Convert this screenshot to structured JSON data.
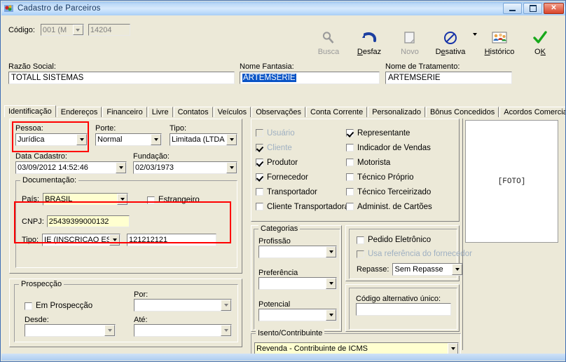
{
  "window": {
    "title": "Cadastro de Parceiros",
    "icon": "app-icon",
    "minimize_label": "Minimizar",
    "maximize_label": "Maximizar",
    "close_label": "Fechar"
  },
  "toolbar": {
    "codigo_label": "Código:",
    "codigo_combo_value": "001 (M",
    "codigo_number_value": "14204",
    "buttons": [
      {
        "label": "Busca",
        "underline": "B",
        "icon": "magnifier-icon",
        "disabled": true
      },
      {
        "label": "Desfaz",
        "underline": "D",
        "icon": "undo-arrow-icon",
        "disabled": false
      },
      {
        "label": "Novo",
        "underline": "N",
        "icon": "new-document-icon",
        "disabled": true
      },
      {
        "label": "Desativa",
        "underline": "e",
        "icon": "no-entry-icon",
        "disabled": false
      },
      {
        "label": "Histórico",
        "underline": "H",
        "icon": "people-icon",
        "disabled": false
      },
      {
        "label": "OK",
        "underline": "K",
        "icon": "green-check-icon",
        "disabled": false
      }
    ],
    "dropdown_caret": "chevron-down-icon"
  },
  "header_fields": {
    "razao_social": {
      "label": "Razão Social:",
      "value": "TOTALL SISTEMAS"
    },
    "nome_fantasia": {
      "label": "Nome Fantasia:",
      "value": "ARTEMSERIE",
      "selected": true
    },
    "nome_tratamento": {
      "label": "Nome de Tratamento:",
      "value": "ARTEMSERIE"
    }
  },
  "tabs": [
    {
      "label": "Identificação",
      "active": true
    },
    {
      "label": "Endereços",
      "active": false
    },
    {
      "label": "Financeiro",
      "active": false
    },
    {
      "label": "Livre",
      "active": false
    },
    {
      "label": "Contatos",
      "active": false
    },
    {
      "label": "Veículos",
      "active": false
    },
    {
      "label": "Observações",
      "active": false
    },
    {
      "label": "Conta Corrente",
      "active": false
    },
    {
      "label": "Personalizado",
      "active": false
    },
    {
      "label": "Bônus Concedidos",
      "active": false
    },
    {
      "label": "Acordos Comerciais",
      "active": false
    }
  ],
  "identificacao": {
    "pessoa": {
      "label": "Pessoa:",
      "value": "Jurídica",
      "highlighted": true
    },
    "porte": {
      "label": "Porte:",
      "value": "Normal"
    },
    "tipo": {
      "label": "Tipo:",
      "value": "Limitada (LTDA"
    },
    "data_cadastro": {
      "label": "Data Cadastro:",
      "value": "03/09/2012 14:52:46"
    },
    "fundacao": {
      "label": "Fundação:",
      "value": "02/03/1973"
    },
    "documentacao": {
      "title": "Documentação:",
      "pais": {
        "label": "País:",
        "value": "BRASIL"
      },
      "estrangeiro": {
        "label": "Estrangeiro",
        "checked": false
      },
      "cnpj": {
        "label": "CNPJ:",
        "value": "25439399000132"
      },
      "tipo_doc": {
        "label": "Tipo:",
        "value": "IE (INSCRICAO ESTAD"
      },
      "tipo_doc_numero": {
        "value": "121212121"
      },
      "highlighted": true
    },
    "prospeccao": {
      "title": "Prospecção",
      "em_prospeccao": {
        "label": "Em Prospecção",
        "checked": false
      },
      "por": {
        "label": "Por:",
        "value": ""
      },
      "desde": {
        "label": "Desde:",
        "value": ""
      },
      "ate": {
        "label": "Até:",
        "value": ""
      }
    }
  },
  "roles": {
    "column_left": [
      {
        "label": "Usuário",
        "checked": false,
        "disabled": true
      },
      {
        "label": "Cliente",
        "checked": true,
        "disabled": true
      },
      {
        "label": "Produtor",
        "checked": true,
        "disabled": false
      },
      {
        "label": "Fornecedor",
        "checked": true,
        "disabled": false
      },
      {
        "label": "Transportador",
        "checked": false,
        "disabled": false
      },
      {
        "label": "Cliente Transportadora",
        "checked": false,
        "disabled": false
      }
    ],
    "column_right": [
      {
        "label": "Representante",
        "checked": true,
        "disabled": false
      },
      {
        "label": "Indicador de Vendas",
        "checked": false,
        "disabled": false
      },
      {
        "label": "Motorista",
        "checked": false,
        "disabled": false
      },
      {
        "label": "Técnico Próprio",
        "checked": false,
        "disabled": false
      },
      {
        "label": "Técnico Terceirizado",
        "checked": false,
        "disabled": false
      },
      {
        "label": "Administ. de Cartões",
        "checked": false,
        "disabled": false
      }
    ]
  },
  "categorias": {
    "title": "Categorias",
    "profissao": {
      "label": "Profissão",
      "value": ""
    },
    "preferencia": {
      "label": "Preferência",
      "value": ""
    },
    "potencial": {
      "label": "Potencial",
      "value": ""
    }
  },
  "pedido": {
    "pedido_eletronico": {
      "label": "Pedido Eletrônico",
      "checked": false,
      "disabled": false
    },
    "usa_referencia": {
      "label": "Usa referência do fornecedor",
      "checked": false,
      "disabled": true
    },
    "repasse": {
      "label": "Repasse:",
      "value": "Sem Repasse"
    }
  },
  "codigo_alternativo": {
    "label": "Código alternativo único:",
    "value": ""
  },
  "isento_contribuinte": {
    "title": "Isento/Contribuinte",
    "value": "Revenda - Contribuinte de ICMS"
  },
  "foto": {
    "placeholder": "[FOTO]"
  },
  "colors": {
    "titlebar_blue": "#9dc4ef",
    "face": "#ece9d8",
    "highlight_red": "#ff0000",
    "field_yellow": "#ffffd0",
    "selection_blue": "#0a54c6"
  }
}
